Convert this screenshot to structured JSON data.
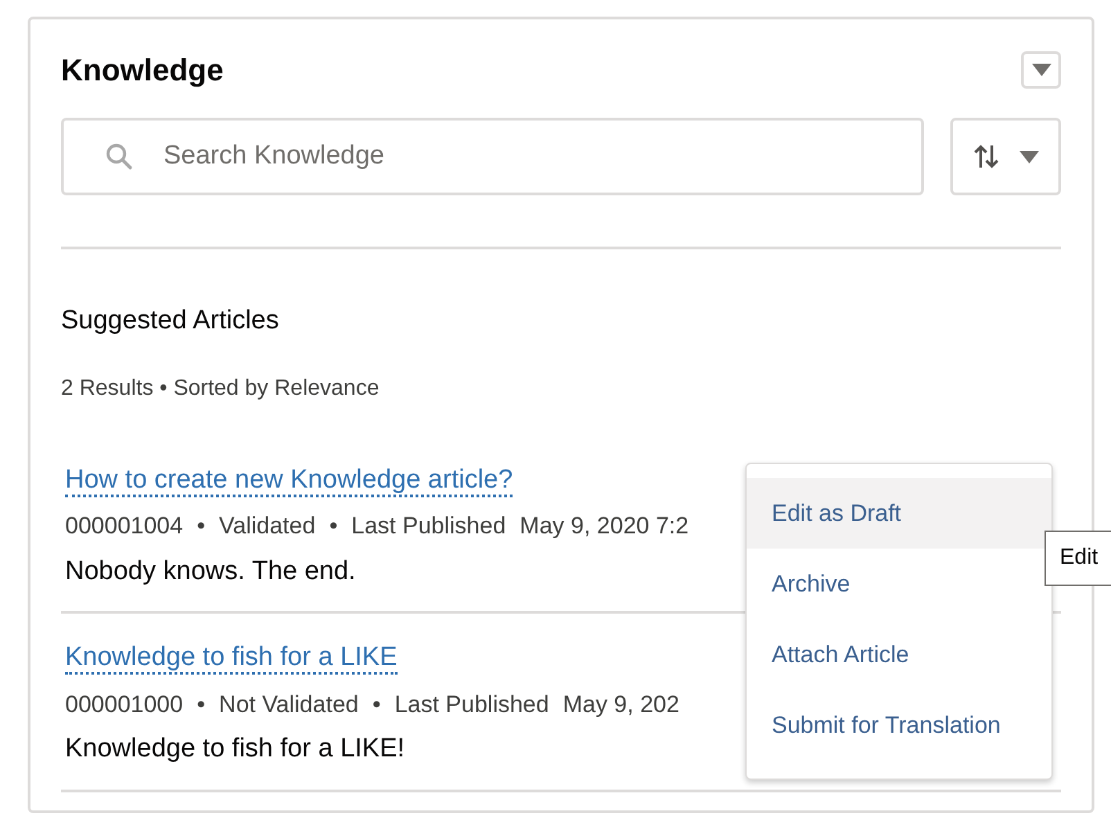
{
  "card": {
    "title": "Knowledge"
  },
  "search": {
    "placeholder": "Search Knowledge"
  },
  "section": {
    "title": "Suggested Articles",
    "summary": "2 Results • Sorted by Relevance"
  },
  "articles": [
    {
      "title": "How to create new Knowledge article?",
      "number": "000001004",
      "separator": "•",
      "status": "Validated",
      "published_label": "Last Published",
      "published_date": "May 9, 2020 7:2",
      "snippet": "Nobody knows. The end."
    },
    {
      "title": "Knowledge to fish for a LIKE",
      "number": "000001000",
      "separator": "•",
      "status": "Not Validated",
      "published_label": "Last Published",
      "published_date": "May 9, 202",
      "snippet": "Knowledge to fish for a LIKE!"
    }
  ],
  "menu": {
    "items": [
      {
        "label": "Edit as Draft",
        "selected": true
      },
      {
        "label": "Archive",
        "selected": false
      },
      {
        "label": "Attach Article",
        "selected": false
      },
      {
        "label": "Submit for Translation",
        "selected": false
      }
    ]
  },
  "tooltip": {
    "text": "Edit"
  }
}
